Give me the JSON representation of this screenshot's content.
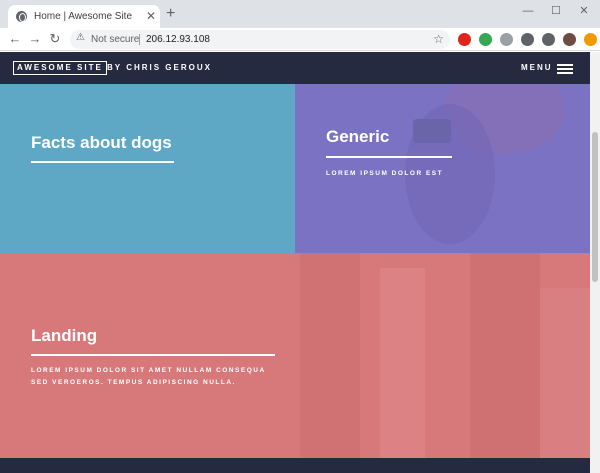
{
  "browser": {
    "tab_title": "Home | Awesome Site",
    "tab_close": "✕",
    "new_tab": "+",
    "window": {
      "minimize": "—",
      "maximize": "☐",
      "close": "✕"
    },
    "nav": {
      "back": "←",
      "forward": "→",
      "reload": "↻"
    },
    "security_icon": "⚠",
    "security_label": "Not secure",
    "url": "206.12.93.108",
    "bookmark_icon": "☆",
    "extensions": [
      {
        "name": "opera-extension-icon",
        "color": "#e2231a"
      },
      {
        "name": "color-picker-extension-icon",
        "color": "#34a853"
      },
      {
        "name": "reader-extension-icon",
        "color": "#9aa0a6"
      },
      {
        "name": "dark-mode-extension-icon",
        "color": "#5f6368"
      },
      {
        "name": "puzzle-extensions-icon",
        "color": "#5f6368"
      },
      {
        "name": "profile-avatar-icon",
        "color": "#6d4c41"
      },
      {
        "name": "update-extension-icon",
        "color": "#f29900"
      }
    ]
  },
  "site": {
    "logo": "AWESOME SITE",
    "byline": "BY CHRIS GEROUX",
    "menu_label": "MENU"
  },
  "tiles": {
    "dogs": {
      "title": "Facts about dogs"
    },
    "generic": {
      "title": "Generic",
      "description": "LOREM IPSUM DOLOR EST"
    },
    "landing": {
      "title": "Landing",
      "description_line1": "LOREM IPSUM DOLOR SIT AMET NULLAM CONSEQUA",
      "description_line2": "SED VEROEROS. TEMPUS ADIPISCING NULLA."
    }
  },
  "colors": {
    "header_bg": "#262a40",
    "tile_blue": "#5ea8c6",
    "tile_purple": "#7b72c3",
    "tile_coral": "#d7787a"
  }
}
